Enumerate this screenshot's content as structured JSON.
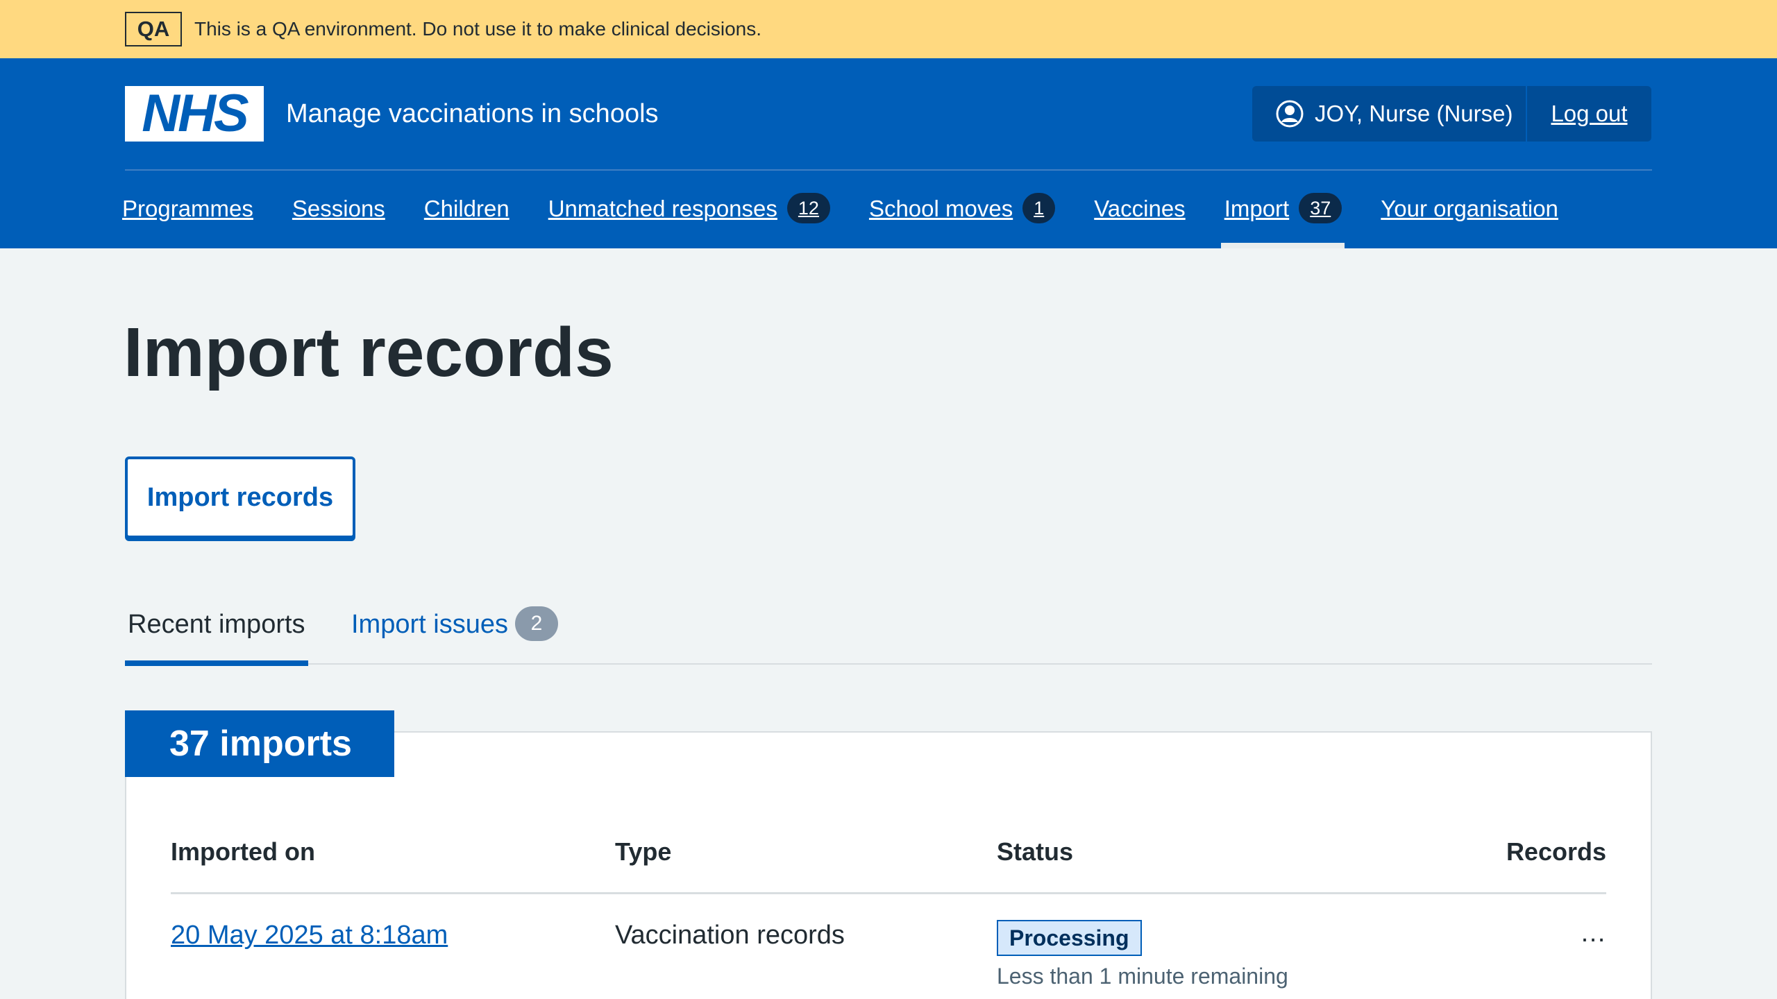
{
  "qa_banner": {
    "tag": "QA",
    "text": "This is a QA environment. Do not use it to make clinical decisions."
  },
  "header": {
    "logo_text": "NHS",
    "service_name": "Manage vaccinations in schools",
    "account": {
      "user": "JOY, Nurse (Nurse)",
      "logout": "Log out"
    },
    "nav": [
      {
        "label": "Programmes",
        "count": null,
        "active": false
      },
      {
        "label": "Sessions",
        "count": null,
        "active": false
      },
      {
        "label": "Children",
        "count": null,
        "active": false
      },
      {
        "label": "Unmatched responses",
        "count": "12",
        "active": false
      },
      {
        "label": "School moves",
        "count": "1",
        "active": false
      },
      {
        "label": "Vaccines",
        "count": null,
        "active": false
      },
      {
        "label": "Import",
        "count": "37",
        "active": true
      },
      {
        "label": "Your organisation",
        "count": null,
        "active": false
      }
    ]
  },
  "main": {
    "title": "Import records",
    "import_button": "Import records",
    "tabs": [
      {
        "label": "Recent imports",
        "badge": null,
        "selected": true
      },
      {
        "label": "Import issues",
        "badge": "2",
        "selected": false
      }
    ],
    "card": {
      "heading": "37 imports",
      "columns": [
        "Imported on",
        "Type",
        "Status",
        "Records"
      ],
      "rows": [
        {
          "imported_on": "20 May 2025 at 8:18am",
          "type": "Vaccination records",
          "status": "Processing",
          "status_note": "Less than 1 minute remaining",
          "records": "…"
        }
      ]
    }
  },
  "colors": {
    "nhs_blue": "#005eb8",
    "qa_banner": "#ffd980",
    "page_bg": "#f0f4f5",
    "text": "#212b32"
  }
}
